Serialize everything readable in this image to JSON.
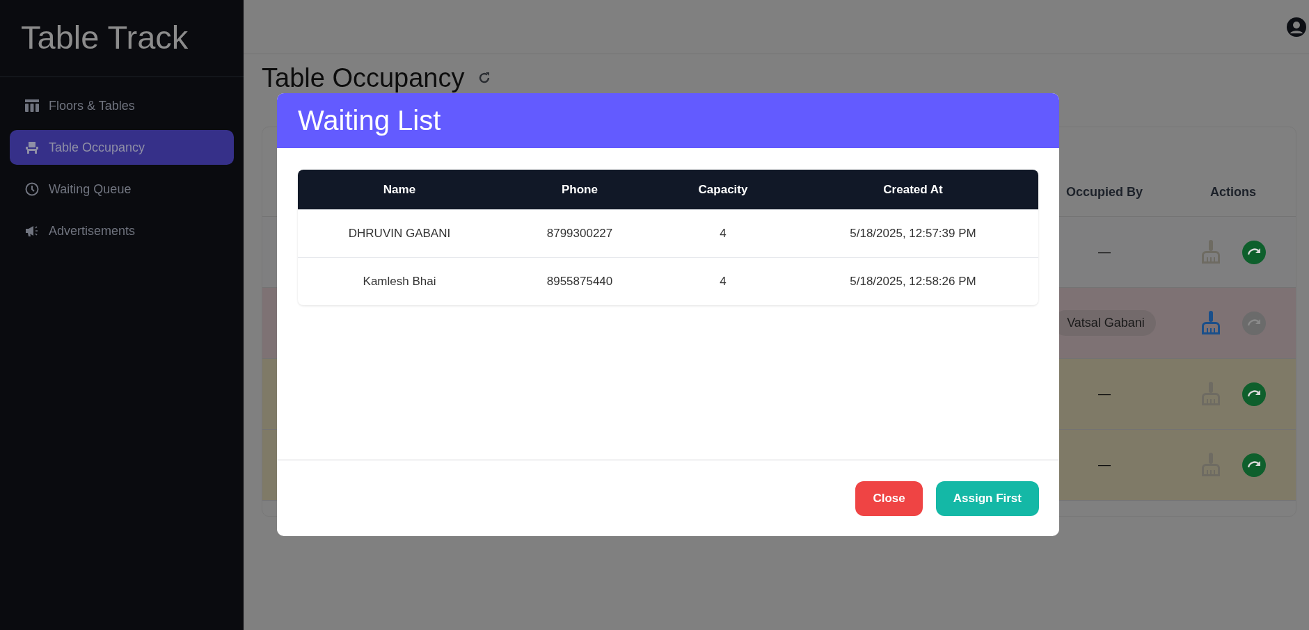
{
  "sidebar": {
    "brand": "Table Track",
    "items": [
      {
        "label": "Floors & Tables",
        "selected": false
      },
      {
        "label": "Table Occupancy",
        "selected": true
      },
      {
        "label": "Waiting Queue",
        "selected": false
      },
      {
        "label": "Advertisements",
        "selected": false
      }
    ]
  },
  "page": {
    "title": "Table Occupancy",
    "table": {
      "columns": [
        "Occupied By",
        "Actions"
      ],
      "rows": [
        {
          "occupied_by": "—",
          "color": "#7f7f80",
          "clean_enabled": false,
          "move_enabled": true
        },
        {
          "occupied_by": "Vatsal Gabani",
          "color": "#7e7274",
          "clean_enabled": true,
          "move_enabled": false
        },
        {
          "occupied_by": "—",
          "color": "#7f7a67",
          "clean_enabled": false,
          "move_enabled": true
        },
        {
          "occupied_by": "—",
          "color": "#7f7a67",
          "clean_enabled": false,
          "move_enabled": true
        }
      ]
    }
  },
  "modal": {
    "title": "Waiting List",
    "columns": [
      "Name",
      "Phone",
      "Capacity",
      "Created At"
    ],
    "rows": [
      [
        "DHRUVIN GABANI",
        "8799300227",
        "4",
        "5/18/2025, 12:57:39 PM"
      ],
      [
        "Kamlesh Bhai",
        "8955875440",
        "4",
        "5/18/2025, 12:58:26 PM"
      ]
    ],
    "buttons": [
      {
        "label": "Close",
        "kind": "danger"
      },
      {
        "label": "Assign First",
        "kind": "primary"
      }
    ]
  }
}
